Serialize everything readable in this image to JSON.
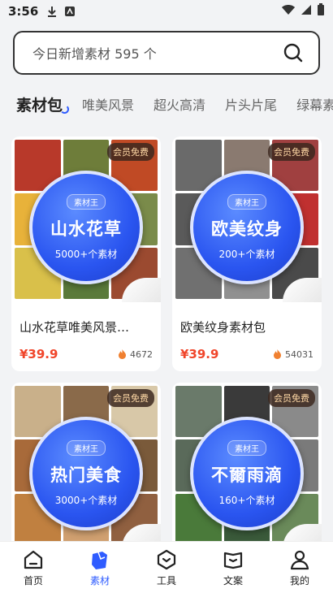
{
  "status_bar": {
    "time": "3:56"
  },
  "search": {
    "placeholder": "今日新增素材 595 个"
  },
  "tabs": [
    {
      "label": "素材包",
      "active": true
    },
    {
      "label": "唯美风景"
    },
    {
      "label": "超火高清"
    },
    {
      "label": "片头片尾"
    },
    {
      "label": "绿幕素"
    }
  ],
  "cards": [
    {
      "badge": "会员免费",
      "disc_tag": "素材王",
      "disc_title": "山水花草",
      "disc_count": "5000+个素材",
      "title": "山水花草唯美风景…",
      "price": "¥39.9",
      "hot": "4672",
      "colors": [
        "#b8392a",
        "#6e7d3a",
        "#c04a25",
        "#e8b23a",
        "#3f6b35",
        "#7a8b4a",
        "#d9c04a",
        "#5a7a3a",
        "#9b4a30"
      ]
    },
    {
      "badge": "会员免费",
      "disc_tag": "素材王",
      "disc_title": "欧美纹身",
      "disc_count": "200+个素材",
      "title": "欧美纹身素材包",
      "price": "¥39.9",
      "hot": "54031",
      "colors": [
        "#6a6a6a",
        "#8a7a70",
        "#a04040",
        "#5a5a5a",
        "#7a6a60",
        "#c03030",
        "#707070",
        "#909090",
        "#4a4a4a"
      ]
    },
    {
      "badge": "会员免费",
      "disc_tag": "素材王",
      "disc_title": "热门美食",
      "disc_count": "3000+个素材",
      "title": "",
      "price": "",
      "hot": "",
      "colors": [
        "#c9b08a",
        "#8a6a4a",
        "#d8c8a8",
        "#a86a3a",
        "#e0b060",
        "#7a5a3a",
        "#c08040",
        "#d0a070",
        "#906040"
      ]
    },
    {
      "badge": "会员免费",
      "disc_tag": "素材王",
      "disc_title": "不爾雨滴",
      "disc_count": "160+个素材",
      "title": "",
      "price": "",
      "hot": "",
      "colors": [
        "#6a7a6a",
        "#3a3a3a",
        "#8a8a8a",
        "#5a6a5a",
        "#2a3a2a",
        "#7a7a7a",
        "#4a7a3a",
        "#3a5a3a",
        "#6a8a5a"
      ]
    }
  ],
  "bottom_nav": [
    {
      "label": "首页"
    },
    {
      "label": "素材",
      "active": true
    },
    {
      "label": "工具"
    },
    {
      "label": "文案"
    },
    {
      "label": "我的"
    }
  ]
}
